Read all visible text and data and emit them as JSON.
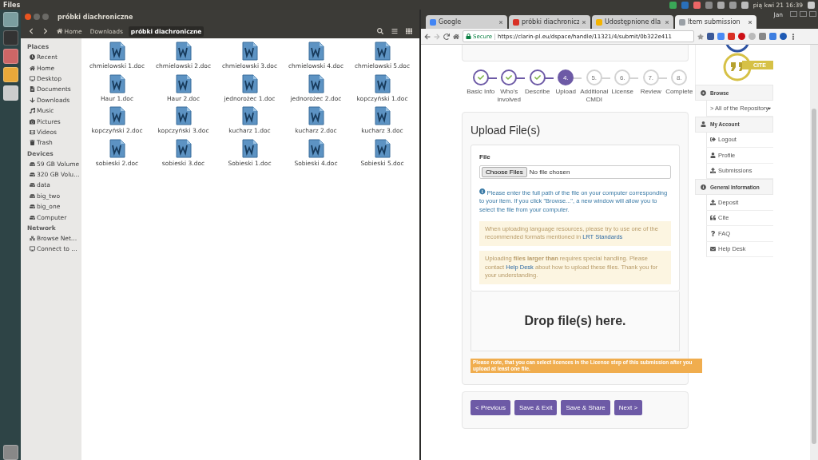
{
  "top_panel": {
    "app_name": "Files",
    "clock": "pią kwi 21 16:39"
  },
  "files_window": {
    "title": "próbki diachroniczne",
    "breadcrumbs": [
      {
        "label": "Home",
        "selected": false
      },
      {
        "label": "Downloads",
        "selected": false
      },
      {
        "label": "próbki diachroniczne",
        "selected": true
      }
    ],
    "sidebar": [
      {
        "heading": "Places",
        "items": [
          "Recent",
          "Home",
          "Desktop",
          "Documents",
          "Downloads",
          "Music",
          "Pictures",
          "Videos",
          "Trash"
        ]
      },
      {
        "heading": "Devices",
        "items": [
          "59 GB Volume",
          "320 GB Volu…",
          "data",
          "big_two",
          "big_one",
          "Computer"
        ]
      },
      {
        "heading": "Network",
        "items": [
          "Browse Net…",
          "Connect to …"
        ]
      }
    ],
    "files": [
      "chmielowski 1.doc",
      "chmielowski 2.doc",
      "chmielowski 3.doc",
      "chmielowski 4.doc",
      "chmielowski 5.doc",
      "Haur 1.doc",
      "Haur 2.doc",
      "jednorożec 1.doc",
      "jednorożec 2.doc",
      "kopczyński 1.doc",
      "kopczyński 2.doc",
      "kopczyński 3.doc",
      "kucharz 1.doc",
      "kucharz 2.doc",
      "kucharz 3.doc",
      "sobieski 2.doc",
      "sobieski 3.doc",
      "Sobieski 1.doc",
      "Sobieski 4.doc",
      "Sobieski 5.doc"
    ]
  },
  "browser": {
    "user": "Jan",
    "tabs": [
      {
        "title": "Google",
        "selected": false
      },
      {
        "title": "próbki diachronicz",
        "selected": false
      },
      {
        "title": "Udostępnione dla",
        "selected": false
      },
      {
        "title": "Item submission",
        "selected": true
      }
    ],
    "security": "Secure",
    "url": "https://clarin-pl.eu/dspace/handle/11321/4/submit/0b322e411"
  },
  "page": {
    "steps": [
      {
        "label": "Basic Info",
        "completed": true,
        "selected": false
      },
      {
        "label": "Who's involved",
        "completed": true,
        "selected": false
      },
      {
        "label": "Describe",
        "completed": true,
        "selected": false
      },
      {
        "number": "4.",
        "label": "Upload",
        "completed": false,
        "selected": true
      },
      {
        "number": "5.",
        "label": "Additional CMDI",
        "completed": false,
        "selected": false
      },
      {
        "number": "6.",
        "label": "License",
        "completed": false,
        "selected": false
      },
      {
        "number": "7.",
        "label": "Review",
        "completed": false,
        "selected": false
      },
      {
        "number": "8.",
        "label": "Complete",
        "completed": false,
        "selected": false
      }
    ],
    "upload": {
      "heading": "Upload File(s)",
      "field_label": "File",
      "choose_button": "Choose Files",
      "no_file": "No file chosen",
      "info": "Please enter the full path of the file on your computer corresponding to your item. If you click \"Browse...\", a new window will allow you to select the file from your computer.",
      "notices": [
        {
          "before": "When uploading language resources, please try to use one of the recommended formats mentioned in ",
          "link": "LRT Standards"
        },
        {
          "before": "Uploading **files larger than** requires special handling. Please contact ",
          "link": "Help Desk",
          "after": " about how to upload these files. Thank you for your understanding."
        }
      ],
      "drop_text": "Drop file(s) here.",
      "license_note": "Please note, that you can select licences in the License step of this submission after you upload at least one file."
    },
    "buttons": [
      "< Previous",
      "Save & Exit",
      "Save & Share",
      "Next >"
    ],
    "sidebar": {
      "cite_label": "CITE",
      "sections": [
        {
          "heading": "Browse",
          "items": [
            "> All of the Repository"
          ]
        },
        {
          "heading": "My Account",
          "items": [
            "Logout",
            "Profile",
            "Submissions"
          ]
        },
        {
          "heading": "General Information",
          "items": [
            "Deposit",
            "Cite",
            "FAQ",
            "Help Desk"
          ]
        }
      ]
    }
  }
}
